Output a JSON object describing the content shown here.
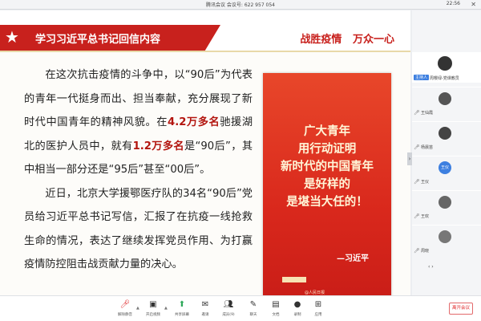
{
  "titlebar": {
    "meeting_title": "腾讯会议 会议号: 622 957 054",
    "clock": "22:56",
    "close": "✕"
  },
  "slide": {
    "title": "学习习近平总书记回信内容",
    "slogan": "战胜疫情   万众一心",
    "p1_a": "在这次抗击疫情的斗争中，以“90后”为代表的青年一代挺身而出、担当奉献，充分展现了新时代中国青年的精神风貌。在",
    "p1_b": "4.2万多名",
    "p1_c": "驰援湖北的医护人员中，就有",
    "p1_d": "1.2万多名",
    "p1_e": "是“90后”，其中相当一部分还是“95后”甚至“00后”。",
    "p2": "近日，北京大学援鄂医疗队的34名“90后”党员给习近平总书记写信，汇报了在抗疫一线抢救生命的情况，表达了继续发挥党员作用、为打赢疫情防控阻击战贡献力量的决心。",
    "poster": {
      "line1": "广大青年",
      "line2": "用行动证明",
      "line3": "新时代的中国青年",
      "line4": "是好样的",
      "line5": "是堪当大任的！",
      "sign": "—习近平",
      "credit": "@人民日报"
    }
  },
  "participants": [
    {
      "tag": "主持人",
      "name": "周樱绿-党课教员",
      "avatar_color": "#333333",
      "active": true
    },
    {
      "tag": "",
      "name": "王仙霞",
      "avatar_color": "#555555"
    },
    {
      "tag": "",
      "name": "杨晨苗",
      "avatar_color": "#444444"
    },
    {
      "tag": "",
      "name": "王仪",
      "avatar_color": "#3d7fe0",
      "avatar_text": "王仪"
    },
    {
      "tag": "",
      "name": "王欢",
      "avatar_color": "#666666"
    },
    {
      "tag": "",
      "name": "周晓",
      "avatar_color": "#777777"
    }
  ],
  "toolbar": {
    "mute": "解除静音",
    "video": "开启视频",
    "share": "共享屏幕",
    "invite": "邀请",
    "members": "成员(9)",
    "chat": "聊天",
    "docs": "文档",
    "record": "录制",
    "apps": "应用",
    "leave": "离开会议"
  },
  "icons": {
    "star": "★",
    "mic": "🎤︎",
    "video": "▣",
    "share": "⬆",
    "invite": "✉",
    "members": "👥︎",
    "chat": "✎",
    "docs": "▤",
    "record": "●",
    "apps": "⊞"
  }
}
